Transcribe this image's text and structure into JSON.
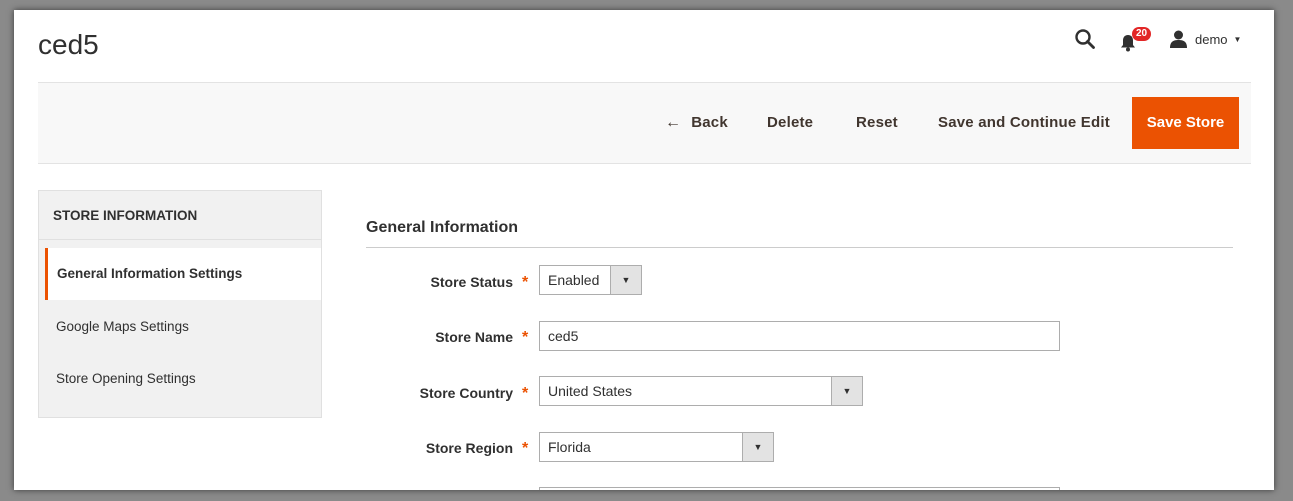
{
  "header": {
    "page_title": "ced5",
    "notification_count": "20",
    "user_name": "demo"
  },
  "toolbar": {
    "back_label": "Back",
    "delete_label": "Delete",
    "reset_label": "Reset",
    "save_continue_label": "Save and Continue Edit",
    "save_store_label": "Save Store"
  },
  "sidebar": {
    "title": "STORE INFORMATION",
    "items": [
      {
        "label": "General Information Settings",
        "active": true
      },
      {
        "label": "Google Maps Settings",
        "active": false
      },
      {
        "label": "Store Opening Settings",
        "active": false
      }
    ]
  },
  "form": {
    "section_title": "General Information",
    "fields": {
      "store_status": {
        "label": "Store Status",
        "value": "Enabled"
      },
      "store_name": {
        "label": "Store Name",
        "value": "ced5"
      },
      "store_country": {
        "label": "Store Country",
        "value": "United States"
      },
      "store_region": {
        "label": "Store Region",
        "value": "Florida"
      }
    },
    "required_marker": "*"
  },
  "colors": {
    "accent": "#eb5202",
    "badge": "#e22626"
  }
}
